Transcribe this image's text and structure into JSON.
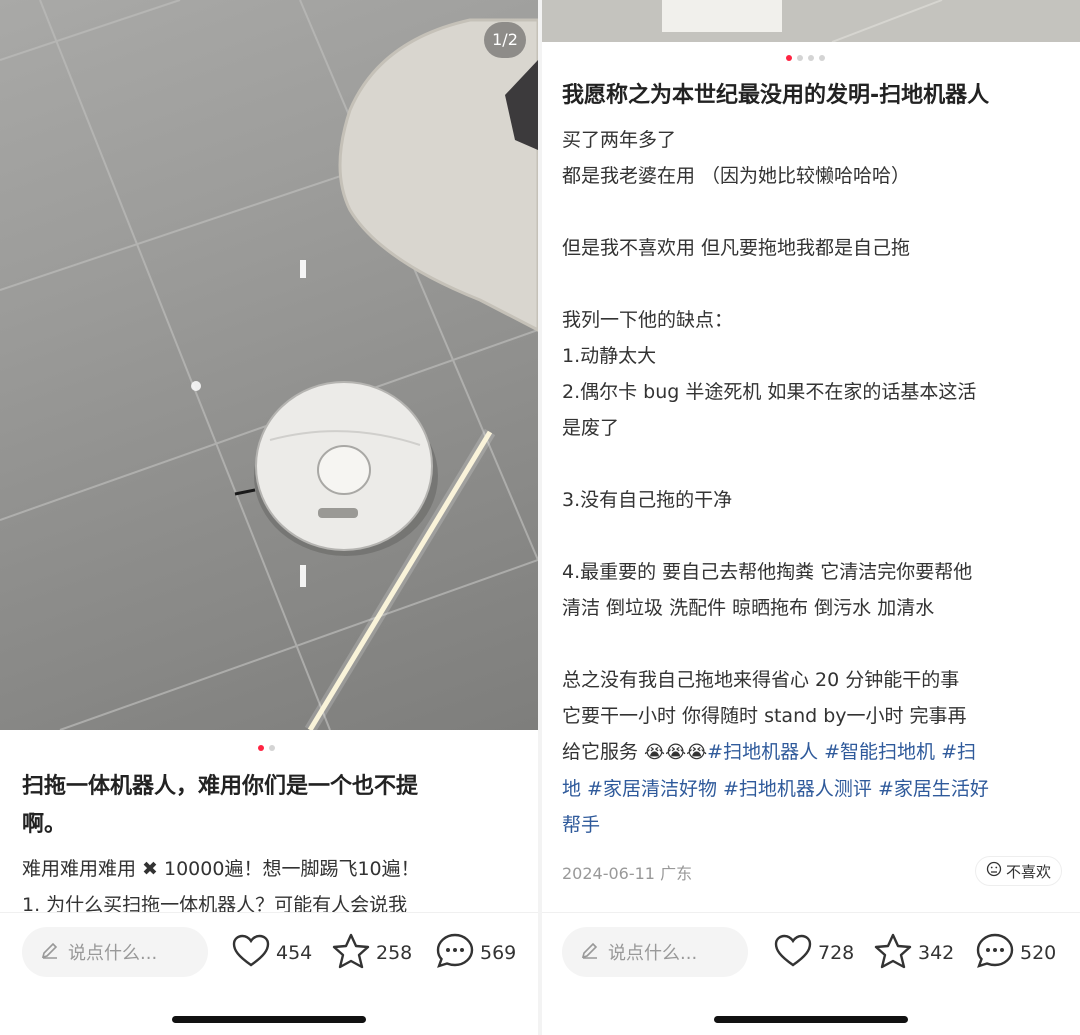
{
  "left": {
    "page_counter": "1/2",
    "title_lines": [
      "扫拖一体机器人，难用你们是一个也不提",
      "啊。"
    ],
    "body_lines": [
      "难用难用难用 ✖ 10000遍！想一脚踢飞10遍！",
      "1.  为什么买扫拖一体机器人？可能有人会说我"
    ],
    "comment_placeholder": "说点什么...",
    "likes": "454",
    "stars": "258",
    "comments": "569"
  },
  "right": {
    "title": "我愿称之为本世纪最没用的发明-扫地机器人",
    "body_lines": [
      "买了两年多了",
      "都是我老婆在用  （因为她比较懒哈哈哈）",
      "",
      "但是我不喜欢用  但凡要拖地我都是自己拖",
      "",
      "我列一下他的缺点：",
      "1.动静太大",
      "2.偶尔卡 bug  半途死机 如果不在家的话基本这活",
      "是废了",
      "",
      "3.没有自己拖的干净",
      "",
      "4.最重要的  要自己去帮他掏粪  它清洁完你要帮他",
      "清洁  倒垃圾 洗配件 晾晒拖布 倒污水 加清水",
      "",
      "总之没有我自己拖地来得省心  20 分钟能干的事",
      "它要干一小时  你得随时 stand by一小时  完事再"
    ],
    "line_18_text": "给它服务 ",
    "line_18_emojis": "😭😭😭",
    "tags_line_18": "#扫地机器人 #智能扫地机 #扫",
    "tags_line_19": "地 #家居清洁好物 #扫地机器人测评 #家居生活好",
    "tags_line_20": "帮手",
    "date": "2024-06-11 广东",
    "dislike_label": "不喜欢",
    "comment_placeholder": "说点什么...",
    "likes": "728",
    "stars": "342",
    "comments": "520"
  },
  "colors": {
    "accent": "#ff2442",
    "hashtag": "#2f5a9b"
  },
  "icons": [
    "pencil-icon",
    "heart-icon",
    "star-icon",
    "comment-bubble-icon",
    "dislike-face-icon"
  ]
}
